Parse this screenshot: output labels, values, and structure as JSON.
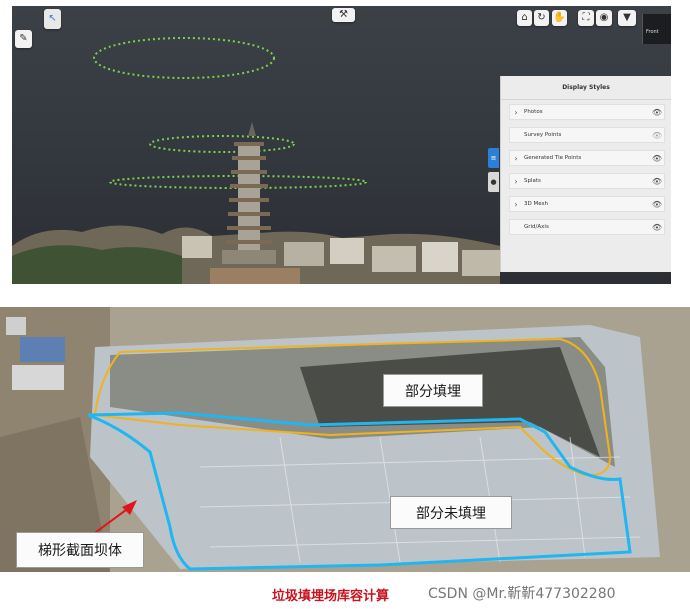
{
  "viewer": {
    "toolbar_left": {
      "select_icon": "cursor-select-icon",
      "edit_icon": "pencil-icon"
    },
    "toolbar_center": {
      "icon": "tools-icon"
    },
    "toolbar_right": [
      {
        "name": "home-view-button",
        "icon": "home-icon"
      },
      {
        "name": "rotate-button",
        "icon": "rotate-icon"
      },
      {
        "name": "pan-button",
        "icon": "hand-icon"
      },
      {
        "name": "fit-view-button",
        "icon": "fit-view-icon"
      },
      {
        "name": "visibility-button",
        "icon": "eye-icon"
      },
      {
        "name": "filter-button",
        "icon": "filter-icon"
      }
    ],
    "view_label": "Front",
    "display_styles": {
      "title": "Display Styles",
      "items": [
        {
          "label": "Photos",
          "expandable": true,
          "visible": true
        },
        {
          "label": "Survey Points",
          "expandable": false,
          "visible": false
        },
        {
          "label": "Generated Tie Points",
          "expandable": true,
          "visible": false
        },
        {
          "label": "Splats",
          "expandable": true,
          "visible": false
        },
        {
          "label": "3D Mesh",
          "expandable": true,
          "visible": true
        },
        {
          "label": "Grid/Axis",
          "expandable": false,
          "visible": true
        }
      ]
    },
    "side_tabs": [
      {
        "name": "layers-tab",
        "icon": "layers-icon",
        "active": true
      },
      {
        "name": "globe-tab",
        "icon": "globe-icon",
        "active": false
      }
    ],
    "colors": {
      "accent": "#2c7ed6",
      "orbit_points": "#7bd24c"
    }
  },
  "map": {
    "labels": {
      "filled": "部分填埋",
      "unfilled": "部分未填埋",
      "dam": "梯形截面坝体"
    },
    "colors": {
      "blue_boundary": "#1fb6f2",
      "yellow_boundary": "#f0b31c",
      "arrow": "#e0141c"
    }
  },
  "caption": "垃圾填埋场库容计算",
  "watermark": "CSDN @Mr.靳靳477302280"
}
